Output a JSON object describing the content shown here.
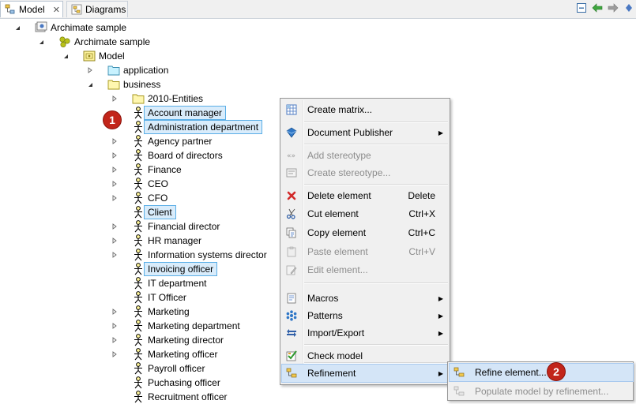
{
  "tabs": [
    {
      "label": "Model",
      "active": true,
      "icon": "model-tree-icon",
      "closable": true
    },
    {
      "label": "Diagrams",
      "active": false,
      "icon": "diagrams-icon"
    }
  ],
  "tree": {
    "root": "Archimate sample",
    "project": "Archimate sample",
    "model": "Model",
    "folders": [
      "application",
      "business"
    ],
    "subfolder": "2010-Entities",
    "actors": [
      {
        "label": "Account manager",
        "selected": true,
        "expandable": false
      },
      {
        "label": "Administration department",
        "selected": true,
        "expandable": false
      },
      {
        "label": "Agency partner",
        "selected": false,
        "expandable": true
      },
      {
        "label": "Board of directors",
        "selected": false,
        "expandable": true
      },
      {
        "label": "Finance",
        "selected": false,
        "expandable": true
      },
      {
        "label": "CEO",
        "selected": false,
        "expandable": true
      },
      {
        "label": "CFO",
        "selected": false,
        "expandable": true
      },
      {
        "label": "Client",
        "selected": true,
        "expandable": false
      },
      {
        "label": "Financial director",
        "selected": false,
        "expandable": true
      },
      {
        "label": "HR manager",
        "selected": false,
        "expandable": true
      },
      {
        "label": "Information systems director",
        "selected": false,
        "expandable": true
      },
      {
        "label": "Invoicing officer",
        "selected": true,
        "expandable": false
      },
      {
        "label": "IT department",
        "selected": false,
        "expandable": false
      },
      {
        "label": "IT Officer",
        "selected": false,
        "expandable": false
      },
      {
        "label": "Marketing",
        "selected": false,
        "expandable": true
      },
      {
        "label": "Marketing department",
        "selected": false,
        "expandable": true
      },
      {
        "label": "Marketing director",
        "selected": false,
        "expandable": true
      },
      {
        "label": "Marketing officer",
        "selected": false,
        "expandable": true
      },
      {
        "label": "Payroll officer",
        "selected": false,
        "expandable": false
      },
      {
        "label": "Puchasing officer",
        "selected": false,
        "expandable": false
      },
      {
        "label": "Recruitment officer",
        "selected": false,
        "expandable": false
      }
    ]
  },
  "badges": {
    "step1": "1",
    "step2": "2"
  },
  "context_menu": {
    "create_matrix": "Create matrix...",
    "document_publisher": "Document Publisher",
    "add_stereotype": "Add stereotype",
    "create_stereotype": "Create stereotype...",
    "delete_element": "Delete element",
    "delete_accel": "Delete",
    "cut_element": "Cut element",
    "cut_accel": "Ctrl+X",
    "copy_element": "Copy element",
    "copy_accel": "Ctrl+C",
    "paste_element": "Paste element",
    "paste_accel": "Ctrl+V",
    "edit_element": "Edit element...",
    "macros": "Macros",
    "patterns": "Patterns",
    "import_export": "Import/Export",
    "check_model": "Check model",
    "refinement": "Refinement"
  },
  "submenu": {
    "refine_element": "Refine element...",
    "populate_model": "Populate model by refinement..."
  },
  "colors": {
    "selection_fill": "#d9ecfb",
    "selection_border": "#5aaee6",
    "badge": "#c2251a",
    "menu_bg": "#f0f0f0",
    "menu_highlight": "#d4e5f7"
  }
}
